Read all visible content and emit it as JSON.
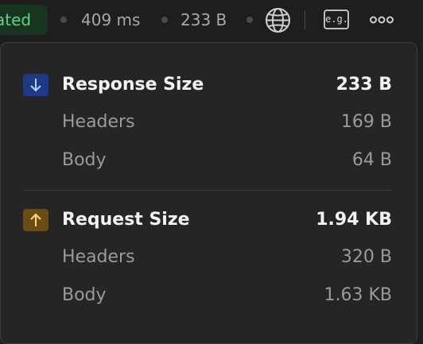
{
  "statusbar": {
    "status_label": "ated",
    "time": "409 ms",
    "size": "233 B",
    "globe_icon": "globe-icon",
    "eg_label": "e.g.",
    "more_icon": "more-icon"
  },
  "sizes": {
    "response": {
      "title": "Response Size",
      "total": "233 B",
      "headers_label": "Headers",
      "headers_value": "169 B",
      "body_label": "Body",
      "body_value": "64 B",
      "icon": "arrow-down-icon",
      "icon_color": "#1c3a86"
    },
    "request": {
      "title": "Request Size",
      "total": "1.94 KB",
      "headers_label": "Headers",
      "headers_value": "320 B",
      "body_label": "Body",
      "body_value": "1.63 KB",
      "icon": "arrow-up-icon",
      "icon_color": "#6a4d12"
    }
  },
  "colors": {
    "status_text": "#5fd38a",
    "status_bg": "#16351f"
  }
}
